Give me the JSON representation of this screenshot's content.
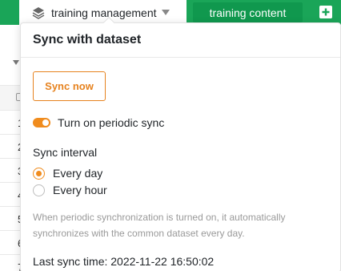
{
  "topbar": {
    "tabs": [
      {
        "label": "training management"
      },
      {
        "label": "training content"
      }
    ],
    "accent_color": "#1aa558"
  },
  "background_rows": [
    "1",
    "2",
    "3",
    "4",
    "5",
    "6",
    "7"
  ],
  "popover": {
    "title": "Sync with dataset",
    "sync_button": "Sync now",
    "periodic_toggle": {
      "label": "Turn on periodic sync",
      "on": true
    },
    "interval": {
      "title": "Sync interval",
      "options": [
        {
          "label": "Every day",
          "selected": true
        },
        {
          "label": "Every hour",
          "selected": false
        }
      ]
    },
    "hint": "When periodic synchronization is turned on, it automatically synchronizes with the common dataset every day.",
    "last_sync": "Last sync time: 2022-11-22 16:50:02",
    "accent_color": "#f08c1e"
  }
}
